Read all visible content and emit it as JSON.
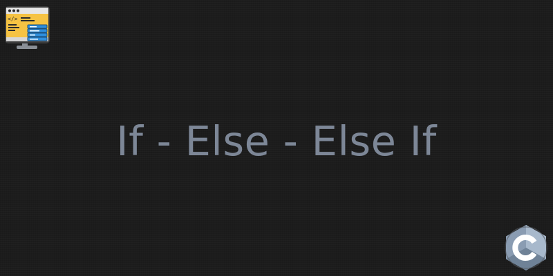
{
  "title": "If - Else - Else If",
  "icons": {
    "top_left": "code-monitor-icon",
    "bottom_right": "c-language-icon"
  },
  "colors": {
    "background": "#1c1c1c",
    "title_text": "#7d8797",
    "monitor_screen": "#f6c343",
    "code_blocks": "#2f8fdd",
    "c_logo": "#a8b9cc"
  }
}
